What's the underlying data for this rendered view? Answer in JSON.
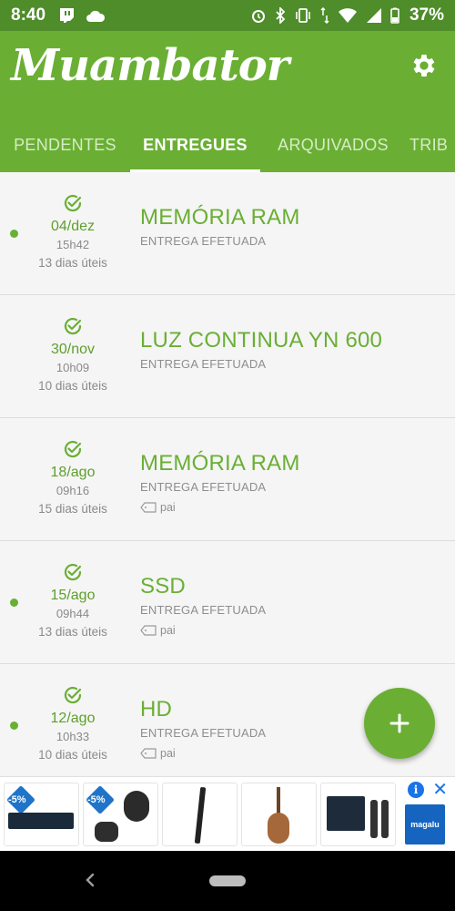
{
  "status_bar": {
    "time": "8:40",
    "battery": "37%"
  },
  "app": {
    "title": "Muambator"
  },
  "tabs": [
    {
      "label": "PENDENTES",
      "active": false
    },
    {
      "label": "ENTREGUES",
      "active": true
    },
    {
      "label": "ARQUIVADOS",
      "active": false
    },
    {
      "label": "TRIB",
      "active": false
    }
  ],
  "items": [
    {
      "date": "04/dez",
      "hour": "15h42",
      "days": "13 dias úteis",
      "title": "MEMÓRIA RAM",
      "status": "ENTREGA EFETUADA",
      "tag": "",
      "unread": true
    },
    {
      "date": "30/nov",
      "hour": "10h09",
      "days": "10 dias úteis",
      "title": "LUZ CONTINUA YN 600",
      "status": "ENTREGA EFETUADA",
      "tag": "",
      "unread": false
    },
    {
      "date": "18/ago",
      "hour": "09h16",
      "days": "15 dias úteis",
      "title": "MEMÓRIA RAM",
      "status": "ENTREGA EFETUADA",
      "tag": "pai",
      "unread": false
    },
    {
      "date": "15/ago",
      "hour": "09h44",
      "days": "13 dias úteis",
      "title": "SSD",
      "status": "ENTREGA EFETUADA",
      "tag": "pai",
      "unread": true
    },
    {
      "date": "12/ago",
      "hour": "10h33",
      "days": "10 dias úteis",
      "title": "HD",
      "status": "ENTREGA EFETUADA",
      "tag": "pai",
      "unread": true
    }
  ],
  "ads": {
    "discount_1": "-5%",
    "discount_2": "-5%",
    "brand": "magalu",
    "info_icon": "i",
    "close_icon": "✕"
  },
  "colors": {
    "primary": "#6aaf34",
    "primary_dark": "#4e8d2a",
    "text_green": "#5e9f2d"
  },
  "icons": {
    "settings": "gear-icon",
    "add": "plus-icon",
    "delivered": "check-circle-icon",
    "tag": "tag-icon"
  }
}
